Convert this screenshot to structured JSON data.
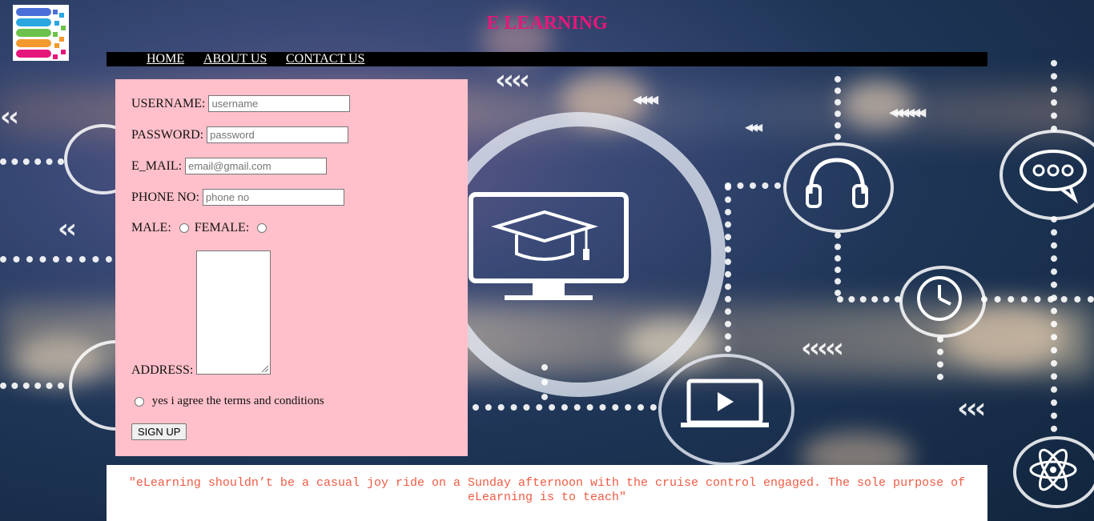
{
  "header": {
    "title": "E LEARNING",
    "logo_icon": "layered-stack-logo-icon"
  },
  "nav": {
    "items": [
      {
        "label": "HOME"
      },
      {
        "label": "ABOUT US"
      },
      {
        "label": "CONTACT US"
      }
    ]
  },
  "form": {
    "username": {
      "label": "USERNAME:",
      "placeholder": "username",
      "value": ""
    },
    "password": {
      "label": "PASSWORD:",
      "placeholder": "password",
      "value": ""
    },
    "email": {
      "label": "E_MAIL:",
      "placeholder": "email@gmail.com",
      "value": ""
    },
    "phone": {
      "label": "PHONE NO:",
      "placeholder": "phone no",
      "value": ""
    },
    "gender": {
      "male_label": "MALE:",
      "female_label": "FEMALE:",
      "selected": null
    },
    "address": {
      "label": "ADDRESS:",
      "value": ""
    },
    "terms": {
      "label": "yes i agree the terms and conditions",
      "checked": false
    },
    "submit_label": "SIGN UP"
  },
  "footer": {
    "quote": "\"eLearning shouldn’t be a casual joy ride on a Sunday afternoon with the cruise control engaged. The sole purpose of eLearning is to teach\""
  },
  "colors": {
    "title": "#e6177a",
    "navbar": "#000000",
    "form_panel": "#ffc0cb",
    "quote_text": "#ef5b43"
  }
}
